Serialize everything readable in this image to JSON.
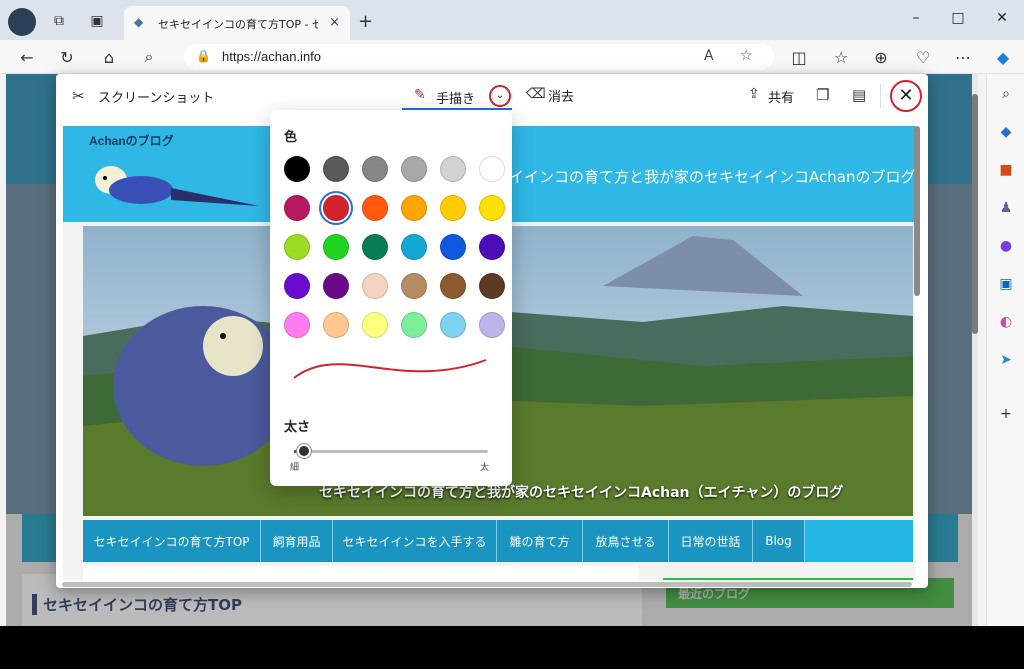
{
  "browser": {
    "tab_title": "セキセイインコの育て方TOP - セキセイ",
    "tab_close": "×",
    "new_tab": "+",
    "url": "https://achan.info",
    "window_controls": [
      "–",
      "□",
      "✕"
    ]
  },
  "page": {
    "heading": "セキセイインコの育て方TOP",
    "side_label": "最近のブログ"
  },
  "screenshot_tool": {
    "title": "スクリーンショット",
    "draw_label": "手描き",
    "erase_label": "消去",
    "share_label": "共有",
    "close_glyph": "✕",
    "caret_glyph": "⌄"
  },
  "captured": {
    "blog_name": "Achanのブログ",
    "tagline": "イインコの育て方と我が家のセキセイインコAchanのブログ",
    "hero_caption": "セキセイインコの育て方と我が家のセキセイインコAchan（エイチャン）のブログ",
    "nav_items": [
      "セキセイインコの育て方TOP",
      "飼育用品",
      "セキセイインコを入手する",
      "雛の育て方",
      "放鳥させる",
      "日常の世話",
      "Blog"
    ]
  },
  "picker": {
    "color_title": "色",
    "thickness_title": "太さ",
    "thin_label": "細",
    "thick_label": "太",
    "selected_color": "#d2222d",
    "thickness_value": 0.02,
    "colors": [
      [
        "#000000",
        "#5a5a5a",
        "#868686",
        "#a8a8a8",
        "#d2d2d2",
        "#ffffff"
      ],
      [
        "#b8185e",
        "#d2222d",
        "#ff5a10",
        "#ffa400",
        "#ffcc00",
        "#ffe000"
      ],
      [
        "#9edc24",
        "#22d422",
        "#0a7d54",
        "#14a8d4",
        "#1058e0",
        "#4b0db8"
      ],
      [
        "#6a0cd0",
        "#6a0a8a",
        "#f4d4c0",
        "#b88c62",
        "#8c5a2c",
        "#5c3a24"
      ],
      [
        "#ff7cf0",
        "#ffc890",
        "#ffff80",
        "#7cf098",
        "#7ed2f2",
        "#bcb4ea"
      ]
    ]
  }
}
